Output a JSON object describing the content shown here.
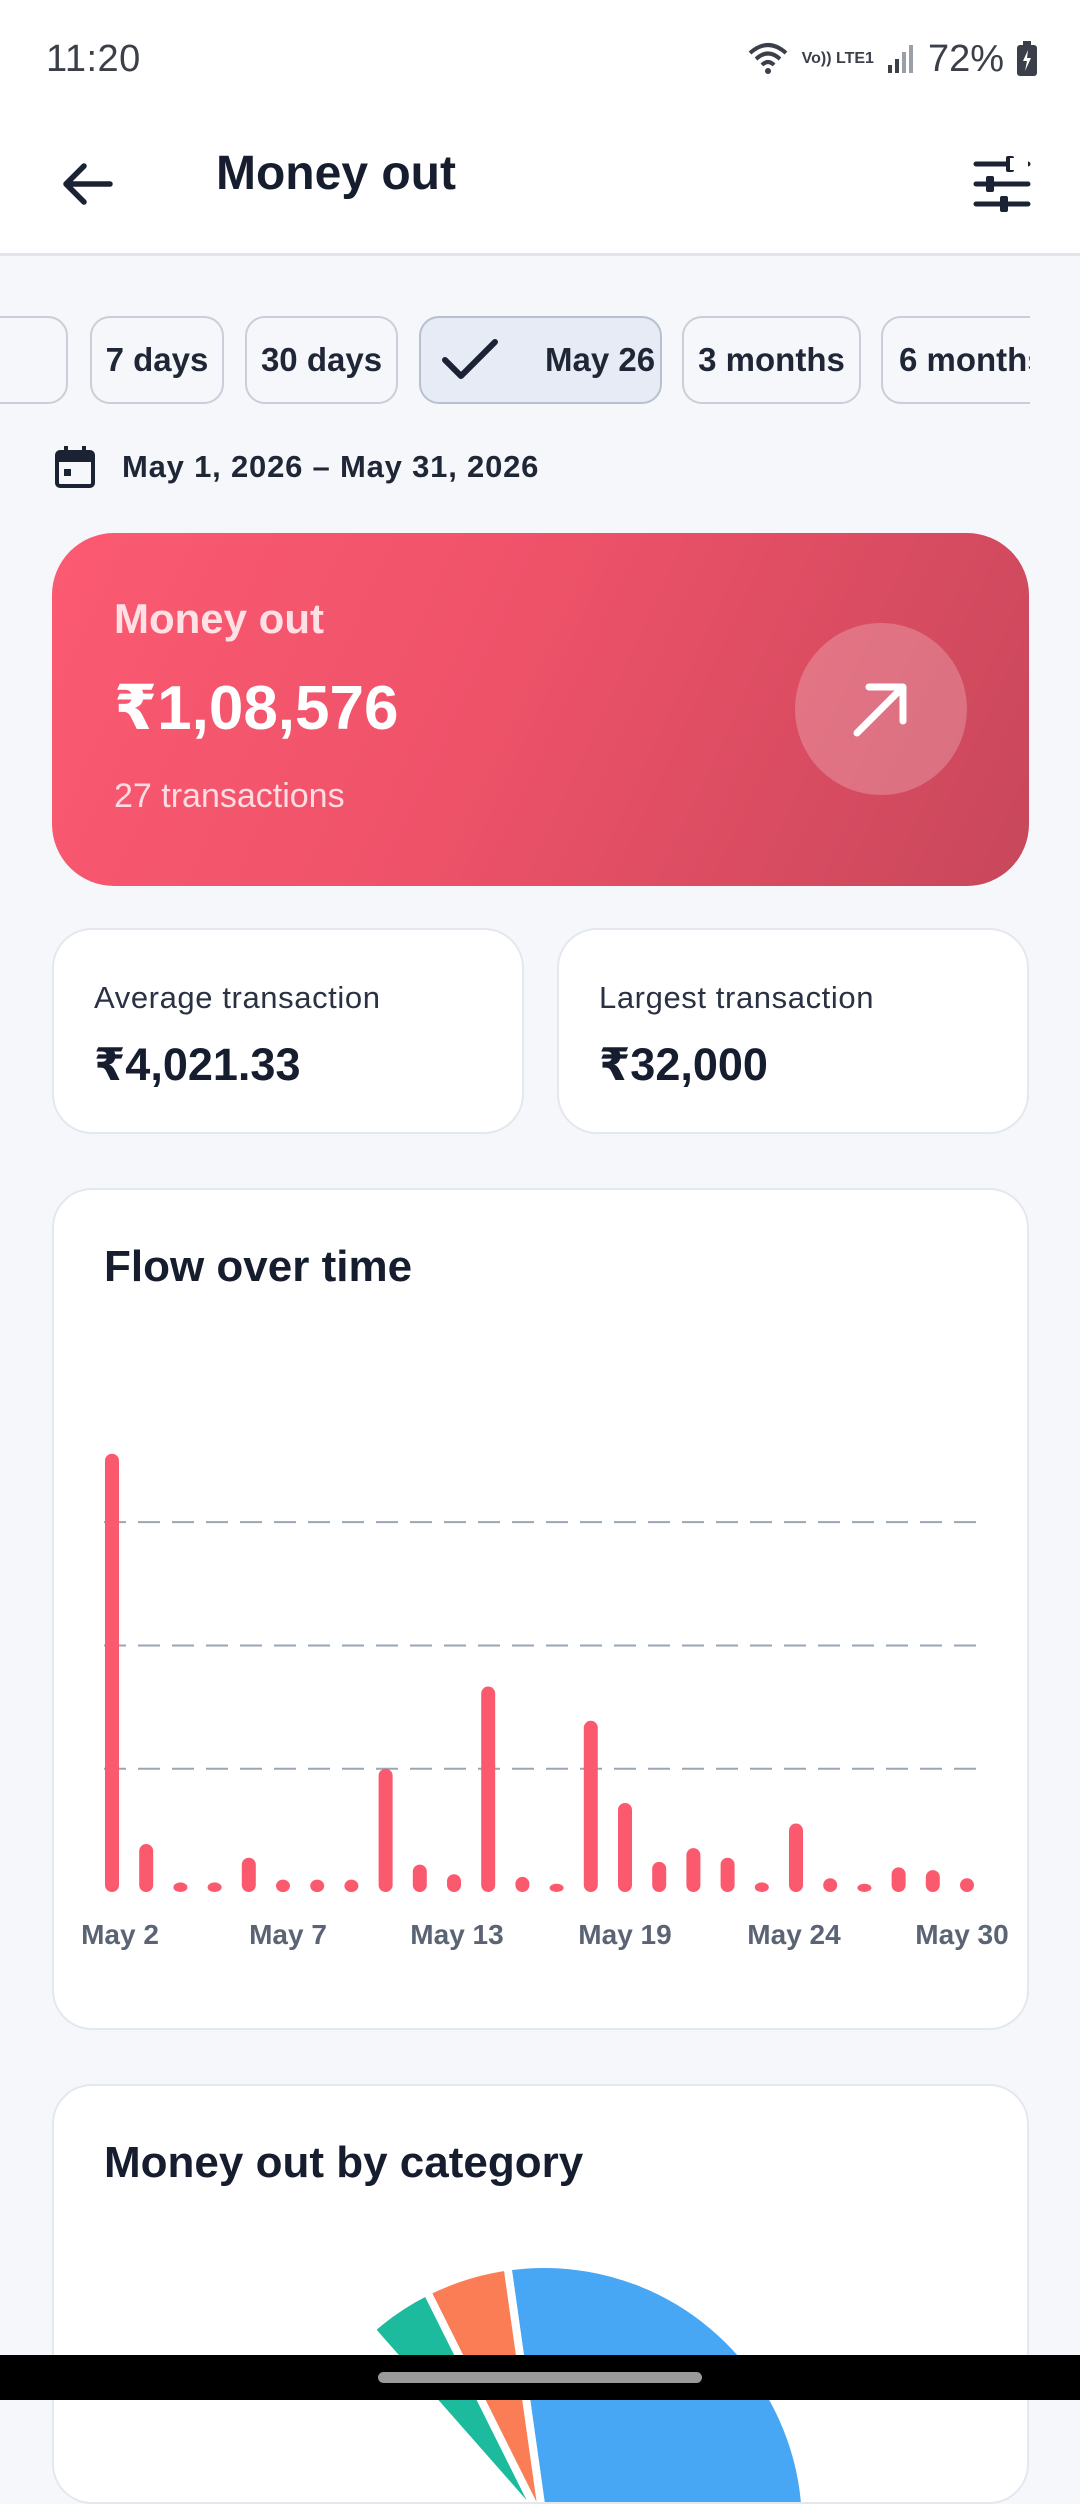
{
  "status_bar": {
    "time": "11:20",
    "battery": "72%",
    "network_label": "Vo)) LTE1"
  },
  "app_bar": {
    "title": "Money out",
    "back_icon": "arrow-left-icon",
    "filter_icon": "sliders-icon"
  },
  "chips": [
    {
      "label": "",
      "selected": false
    },
    {
      "label": "7 days",
      "selected": false
    },
    {
      "label": "30 days",
      "selected": false
    },
    {
      "label": "May 26",
      "selected": true
    },
    {
      "label": "3 months",
      "selected": false
    },
    {
      "label": "6 months",
      "selected": false
    }
  ],
  "date_range": {
    "icon": "calendar-icon",
    "text": "May 1, 2026 – May 31, 2026"
  },
  "hero": {
    "label": "Money out",
    "amount": "₹1,08,576",
    "count": "27 transactions",
    "icon": "arrow-up-right-icon",
    "colors": {
      "start": "#fb5a72",
      "end": "#c8475b"
    }
  },
  "stats": {
    "average": {
      "label": "Average transaction",
      "value": "₹4,021.33"
    },
    "largest": {
      "label": "Largest transaction",
      "value": "₹32,000"
    }
  },
  "flow_chart": {
    "title": "Flow over time"
  },
  "chart_data": {
    "type": "bar",
    "bar_color": "#fb5a6e",
    "grid": "dashed horizontal",
    "x_tick_labels": [
      "May 2",
      "May 7",
      "May 13",
      "May 19",
      "May 24",
      "May 30"
    ],
    "values": [
      32000,
      3500,
      700,
      700,
      2500,
      900,
      900,
      900,
      9000,
      2000,
      1300,
      15000,
      1100,
      600,
      12500,
      6500,
      2200,
      3200,
      2500,
      700,
      5000,
      1000,
      600,
      1800,
      1600,
      1000
    ],
    "ylim": [
      0,
      33000
    ]
  },
  "category_card": {
    "title": "Money out by category",
    "slices": [
      {
        "color": "#48a7f5",
        "value": 52
      },
      {
        "color": "#fb7d56",
        "value": 10
      },
      {
        "color": "#1dbb9e",
        "value": 8
      }
    ]
  }
}
